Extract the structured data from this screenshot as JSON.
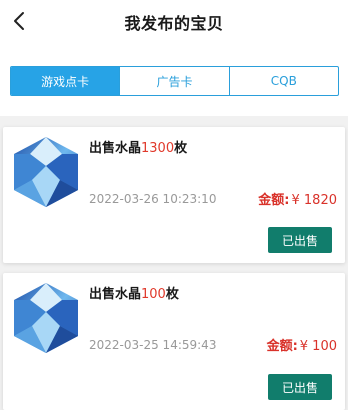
{
  "header": {
    "title": "我发布的宝贝",
    "back_icon": "chevron-left-icon"
  },
  "tabs": [
    {
      "label": "游戏点卡",
      "active": true
    },
    {
      "label": "广告卡",
      "active": false
    },
    {
      "label": "CQB",
      "active": false
    }
  ],
  "listings": [
    {
      "title_prefix": "出售水晶",
      "quantity": "1300",
      "title_suffix": "枚",
      "date": "2022-03-26 10:23:10",
      "amount_label": "金额:",
      "amount_value": "¥ 1820",
      "status_button": "已出售",
      "image_icon": "crystal-image"
    },
    {
      "title_prefix": "出售水晶",
      "quantity": "100",
      "title_suffix": "枚",
      "date": "2022-03-25 14:59:43",
      "amount_label": "金额:",
      "amount_value": "¥ 100",
      "status_button": "已出售",
      "image_icon": "crystal-image"
    }
  ],
  "colors": {
    "accent": "#27a3e6",
    "price": "#d9322a",
    "button": "#117d6c"
  }
}
